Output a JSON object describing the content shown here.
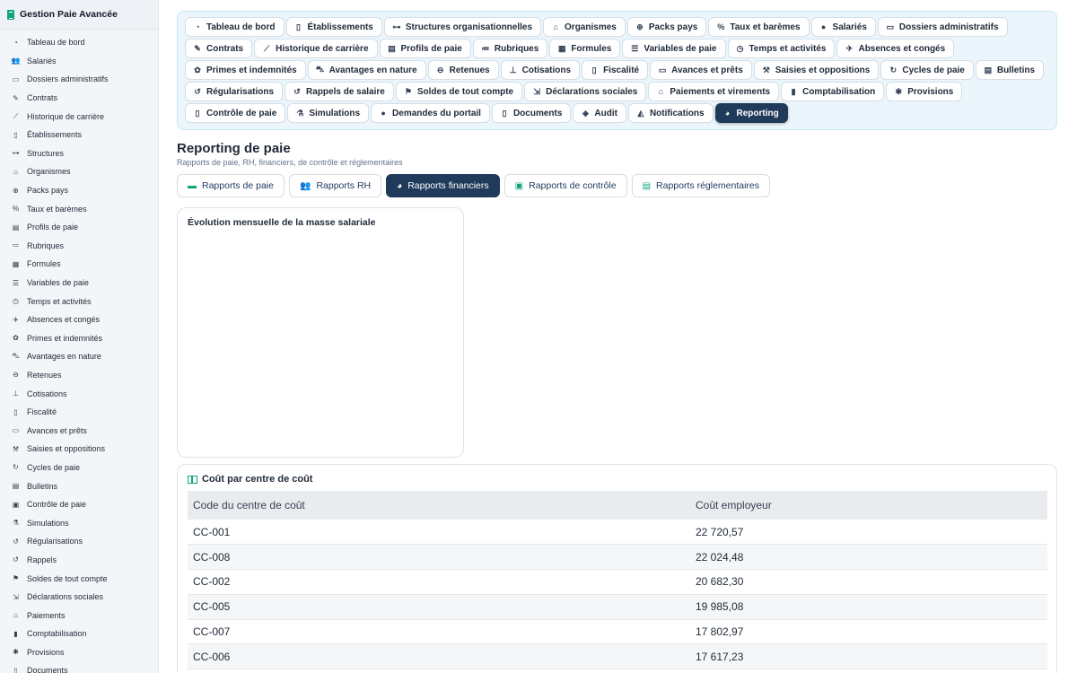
{
  "app": {
    "title": "Gestion Paie Avancée"
  },
  "sidebar": {
    "items": [
      {
        "label": "Tableau de bord",
        "icon": "dashboard-icon"
      },
      {
        "label": "Salariés",
        "icon": "users-icon"
      },
      {
        "label": "Dossiers administratifs",
        "icon": "folder-icon"
      },
      {
        "label": "Contrats",
        "icon": "contract-icon"
      },
      {
        "label": "Historique de carrière",
        "icon": "chart-line-icon"
      },
      {
        "label": "Établissements",
        "icon": "building-icon"
      },
      {
        "label": "Structures",
        "icon": "sitemap-icon"
      },
      {
        "label": "Organismes",
        "icon": "institution-icon"
      },
      {
        "label": "Packs pays",
        "icon": "globe-icon"
      },
      {
        "label": "Taux et barèmes",
        "icon": "percent-icon"
      },
      {
        "label": "Profils de paie",
        "icon": "id-card-icon"
      },
      {
        "label": "Rubriques",
        "icon": "list-icon"
      },
      {
        "label": "Formules",
        "icon": "calculator-icon"
      },
      {
        "label": "Variables de paie",
        "icon": "sliders-icon"
      },
      {
        "label": "Temps et activités",
        "icon": "clock-icon"
      },
      {
        "label": "Absences et congés",
        "icon": "plane-icon"
      },
      {
        "label": "Primes et indemnités",
        "icon": "gift-icon"
      },
      {
        "label": "Avantages en nature",
        "icon": "car-icon"
      },
      {
        "label": "Retenues",
        "icon": "minus-circle-icon"
      },
      {
        "label": "Cotisations",
        "icon": "hand-coins-icon"
      },
      {
        "label": "Fiscalité",
        "icon": "file-invoice-icon"
      },
      {
        "label": "Avances et prêts",
        "icon": "money-check-icon"
      },
      {
        "label": "Saisies et oppositions",
        "icon": "gavel-icon"
      },
      {
        "label": "Cycles de paie",
        "icon": "sync-icon"
      },
      {
        "label": "Bulletins",
        "icon": "receipt-icon"
      },
      {
        "label": "Contrôle de paie",
        "icon": "clipboard-check-icon"
      },
      {
        "label": "Simulations",
        "icon": "flask-icon"
      },
      {
        "label": "Régularisations",
        "icon": "undo-icon"
      },
      {
        "label": "Rappels",
        "icon": "history-icon"
      },
      {
        "label": "Soldes de tout compte",
        "icon": "flag-checkered-icon"
      },
      {
        "label": "Déclarations sociales",
        "icon": "file-export-icon"
      },
      {
        "label": "Paiements",
        "icon": "bank-icon"
      },
      {
        "label": "Comptabilisation",
        "icon": "book-icon"
      },
      {
        "label": "Provisions",
        "icon": "piggy-bank-icon"
      },
      {
        "label": "Documents",
        "icon": "file-icon"
      }
    ]
  },
  "topnav": {
    "items": [
      {
        "label": "Tableau de bord",
        "icon": "dashboard-icon",
        "glyph": "◔"
      },
      {
        "label": "Établissements",
        "icon": "building-icon",
        "glyph": "▯"
      },
      {
        "label": "Structures organisationnelles",
        "icon": "sitemap-icon",
        "glyph": "⊶"
      },
      {
        "label": "Organismes",
        "icon": "institution-icon",
        "glyph": "⌂"
      },
      {
        "label": "Packs pays",
        "icon": "globe-icon",
        "glyph": "⊕"
      },
      {
        "label": "Taux et barèmes",
        "icon": "percent-icon",
        "glyph": "%"
      },
      {
        "label": "Salariés",
        "icon": "user-icon",
        "glyph": "●"
      },
      {
        "label": "Dossiers administratifs",
        "icon": "folder-icon",
        "glyph": "▭"
      },
      {
        "label": "Contrats",
        "icon": "contract-icon",
        "glyph": "✎"
      },
      {
        "label": "Historique de carrière",
        "icon": "chart-line-icon",
        "glyph": "⟋"
      },
      {
        "label": "Profils de paie",
        "icon": "id-card-icon",
        "glyph": "▤"
      },
      {
        "label": "Rubriques",
        "icon": "list-icon",
        "glyph": "≔"
      },
      {
        "label": "Formules",
        "icon": "calculator-icon",
        "glyph": "▦"
      },
      {
        "label": "Variables de paie",
        "icon": "sliders-icon",
        "glyph": "☰"
      },
      {
        "label": "Temps et activités",
        "icon": "clock-icon",
        "glyph": "◷"
      },
      {
        "label": "Absences et congés",
        "icon": "plane-icon",
        "glyph": "✈"
      },
      {
        "label": "Primes et indemnités",
        "icon": "gift-icon",
        "glyph": "✿"
      },
      {
        "label": "Avantages en nature",
        "icon": "car-icon",
        "glyph": "⛍"
      },
      {
        "label": "Retenues",
        "icon": "minus-circle-icon",
        "glyph": "⊖"
      },
      {
        "label": "Cotisations",
        "icon": "hand-coins-icon",
        "glyph": "⊥"
      },
      {
        "label": "Fiscalité",
        "icon": "file-invoice-icon",
        "glyph": "▯"
      },
      {
        "label": "Avances et prêts",
        "icon": "money-check-icon",
        "glyph": "▭"
      },
      {
        "label": "Saisies et oppositions",
        "icon": "gavel-icon",
        "glyph": "⚒"
      },
      {
        "label": "Cycles de paie",
        "icon": "sync-icon",
        "glyph": "↻"
      },
      {
        "label": "Bulletins",
        "icon": "receipt-icon",
        "glyph": "▤"
      },
      {
        "label": "Régularisations",
        "icon": "undo-icon",
        "glyph": "↺"
      },
      {
        "label": "Rappels de salaire",
        "icon": "history-icon",
        "glyph": "↺"
      },
      {
        "label": "Soldes de tout compte",
        "icon": "flag-checkered-icon",
        "glyph": "⚑"
      },
      {
        "label": "Déclarations sociales",
        "icon": "file-export-icon",
        "glyph": "⇲"
      },
      {
        "label": "Paiements et virements",
        "icon": "bank-icon",
        "glyph": "⌂"
      },
      {
        "label": "Comptabilisation",
        "icon": "book-icon",
        "glyph": "▮"
      },
      {
        "label": "Provisions",
        "icon": "piggy-bank-icon",
        "glyph": "✱"
      },
      {
        "label": "Contrôle de paie",
        "icon": "clipboard-check-icon",
        "glyph": "▯"
      },
      {
        "label": "Simulations",
        "icon": "flask-icon",
        "glyph": "⚗"
      },
      {
        "label": "Demandes du portail",
        "icon": "comment-icon",
        "glyph": "●"
      },
      {
        "label": "Documents",
        "icon": "file-icon",
        "glyph": "▯"
      },
      {
        "label": "Audit",
        "icon": "shield-icon",
        "glyph": "◈"
      },
      {
        "label": "Notifications",
        "icon": "bell-icon",
        "glyph": "◭"
      },
      {
        "label": "Reporting",
        "icon": "pie-chart-icon",
        "glyph": "◕",
        "active": true
      }
    ]
  },
  "page": {
    "title": "Reporting de paie",
    "subtitle": "Rapports de paie, RH, financiers, de contrôle et réglementaires"
  },
  "tabs": [
    {
      "label": "Rapports de paie",
      "icon": "money-bill-icon",
      "glyph": "▬",
      "color": "#10a37f"
    },
    {
      "label": "Rapports RH",
      "icon": "users-icon",
      "glyph": "👥",
      "color": "#1e3a5f"
    },
    {
      "label": "Rapports financiers",
      "icon": "pie-chart-icon",
      "glyph": "◕",
      "color": "#ffffff",
      "active": true
    },
    {
      "label": "Rapports de contrôle",
      "icon": "clipboard-check-icon",
      "glyph": "▣",
      "color": "#10a37f"
    },
    {
      "label": "Rapports réglementaires",
      "icon": "file-icon",
      "glyph": "▤",
      "color": "#10a37f"
    }
  ],
  "chart": {
    "title": "Évolution mensuelle de la masse salariale"
  },
  "cost_table": {
    "title": "Coût par centre de coût",
    "columns": [
      "Code du centre de coût",
      "Coût employeur"
    ],
    "rows": [
      [
        "CC-001",
        "22 720,57"
      ],
      [
        "CC-008",
        "22 024,48"
      ],
      [
        "CC-002",
        "20 682,30"
      ],
      [
        "CC-005",
        "19 985,08"
      ],
      [
        "CC-007",
        "17 802,97"
      ],
      [
        "CC-006",
        "17 617,23"
      ]
    ]
  },
  "colors": {
    "accent": "#1f3a5a",
    "brand": "#10a37f",
    "nav_bg": "#eaf6fc"
  }
}
